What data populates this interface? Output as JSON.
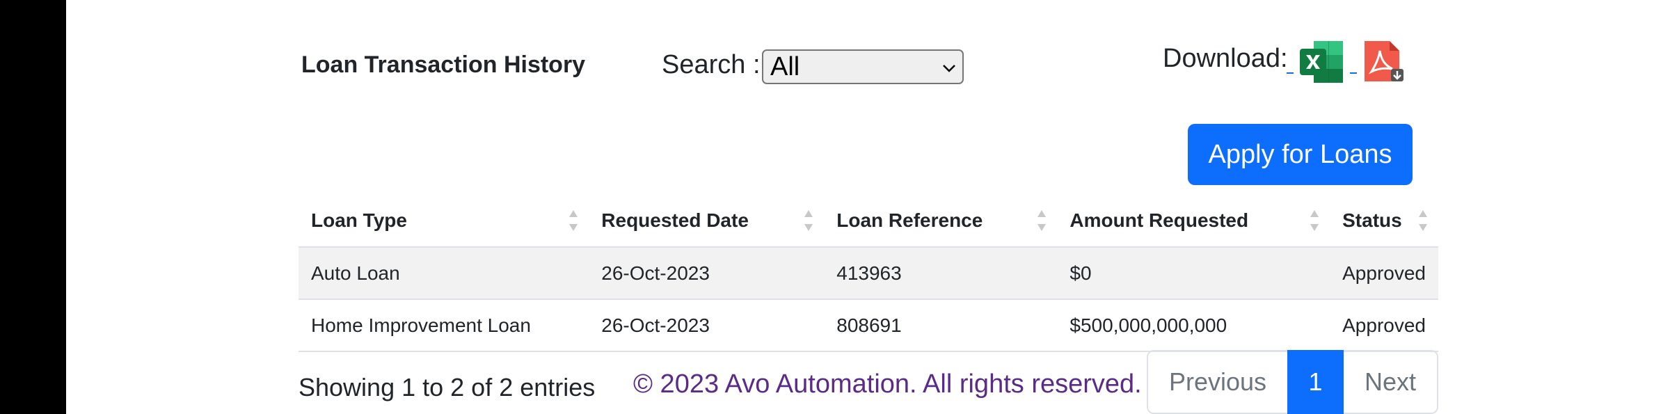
{
  "page": {
    "title": "Loan Transaction History",
    "search_label": "Search :",
    "search_selected": "All",
    "download_label": "Download:",
    "apply_button": "Apply for Loans"
  },
  "icons": {
    "excel": "excel-file-icon",
    "pdf": "pdf-file-icon",
    "sort": "sort-arrows-icon",
    "chevron": "chevron-down-icon"
  },
  "colors": {
    "primary": "#0d6efd",
    "footer_text": "#5b2c87",
    "excel_green": "#1f7a44",
    "pdf_red": "#e8453c"
  },
  "table": {
    "columns": [
      "Loan Type",
      "Requested Date",
      "Loan Reference",
      "Amount Requested",
      "Status"
    ],
    "rows": [
      [
        "Auto Loan",
        "26-Oct-2023",
        "413963",
        "$0",
        "Approved"
      ],
      [
        "Home Improvement Loan",
        "26-Oct-2023",
        "808691",
        "$500,000,000,000",
        "Approved"
      ]
    ]
  },
  "footer": {
    "info": "Showing 1 to 2 of 2 entries",
    "copyright": "© 2023 Avo Automation. All rights reserved."
  },
  "pagination": {
    "previous": "Previous",
    "current": "1",
    "next": "Next"
  }
}
